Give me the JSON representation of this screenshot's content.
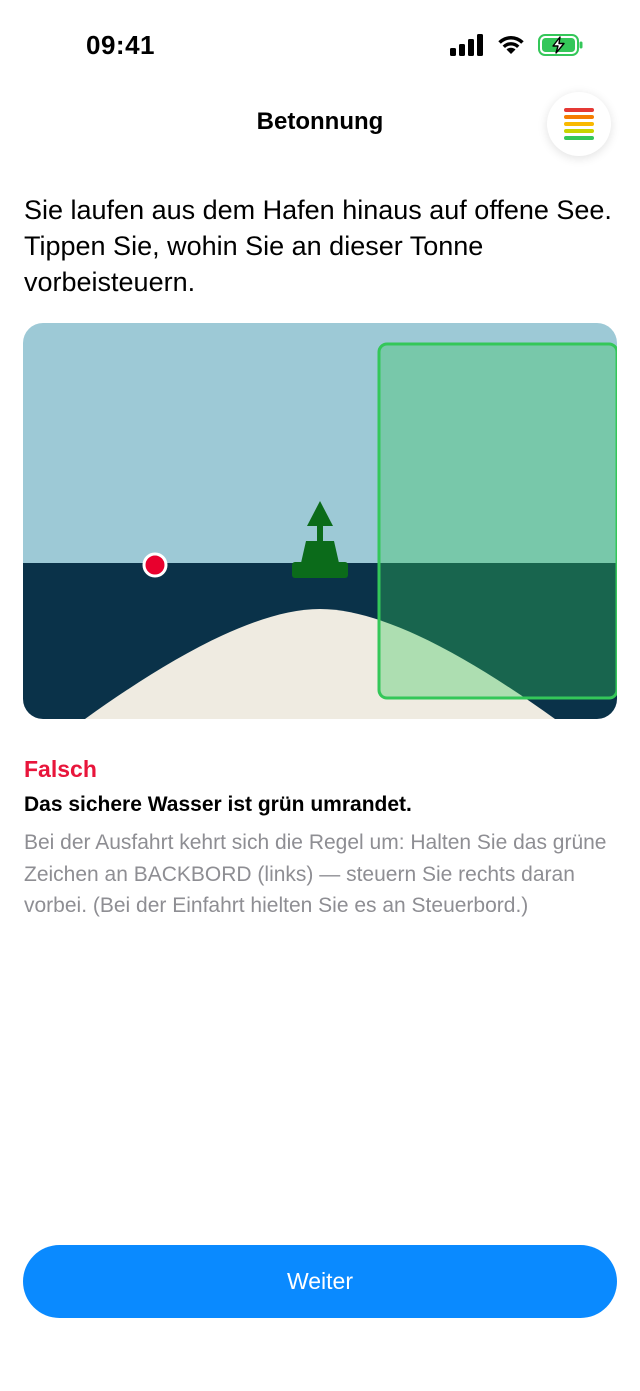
{
  "status_bar": {
    "time": "09:41",
    "icons": [
      "cellular-signal-icon",
      "wifi-icon",
      "battery-charging-icon"
    ]
  },
  "header": {
    "title": "Betonnung",
    "menu_icon": "progress-bars-icon",
    "menu_icon_colors": [
      "#e53935",
      "#f57c00",
      "#f9b800",
      "#c8d400",
      "#34c759"
    ]
  },
  "question": {
    "text": "Sie laufen aus dem Hafen hinaus auf offene See. Tippen Sie, wohin Sie an dieser Tonne vorbeisteuern."
  },
  "scene": {
    "sky_color": "#9dc9d6",
    "water_color": "#0a3249",
    "sand_color": "#efebe1",
    "buoy_color": "#0b6b1a",
    "tap_marker_color": "#e8002d",
    "safe_area_stroke": "#34c759",
    "icons": [
      "green-buoy-icon",
      "tap-marker-icon"
    ]
  },
  "feedback": {
    "status": "Falsch",
    "status_color": "#e8153b",
    "title": "Das sichere Wasser ist grün umrandet.",
    "explanation": "Bei der Ausfahrt kehrt sich die Regel um: Halten Sie das grüne Zeichen an BACKBORD (links) — steuern Sie rechts daran vorbei. (Bei der Einfahrt hielten Sie es an Steuerbord.)"
  },
  "continue_button": {
    "label": "Weiter",
    "color": "#0a8aff"
  }
}
